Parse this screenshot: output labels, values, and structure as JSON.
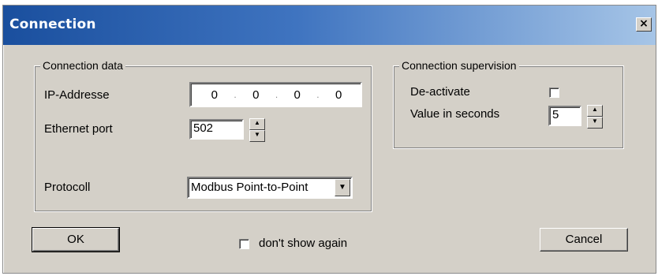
{
  "window": {
    "title": "Connection",
    "close_label": "×"
  },
  "connection_data": {
    "legend": "Connection data",
    "ip_label": "IP-Addresse",
    "ip_octets": [
      "0",
      "0",
      "0",
      "0"
    ],
    "ip_separator": ".",
    "port_label": "Ethernet port",
    "port_value": "502",
    "protocol_label": "Protocoll",
    "protocol_value": "Modbus Point-to-Point"
  },
  "supervision": {
    "legend": "Connection supervision",
    "deactivate_label": "De-activate",
    "deactivate_checked": false,
    "seconds_label": "Value in seconds",
    "seconds_value": "5"
  },
  "footer": {
    "ok_label": "OK",
    "dont_show_label": "don't show again",
    "dont_show_checked": false,
    "cancel_label": "Cancel"
  },
  "icons": {
    "spin_up": "▲",
    "spin_down": "▼",
    "dropdown": "▼"
  }
}
